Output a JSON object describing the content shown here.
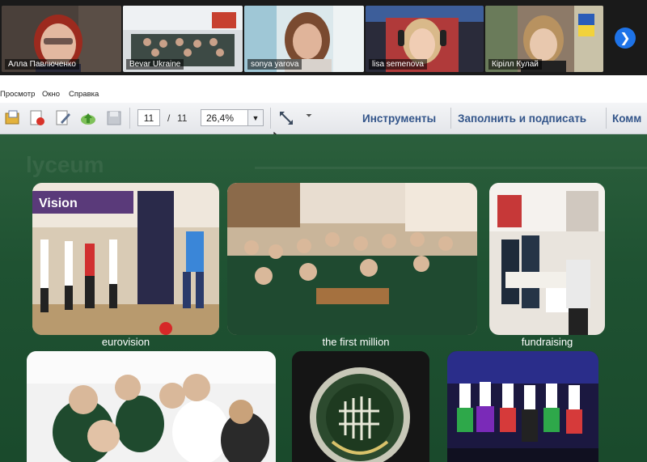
{
  "conference": {
    "participants": [
      {
        "name": "Алла Павлюченко"
      },
      {
        "name": "Bevar Ukraine"
      },
      {
        "name": "sonya yarova"
      },
      {
        "name": "lisa semenova"
      },
      {
        "name": "Кірілл Кулай"
      }
    ],
    "next_icon": "chevron-right-icon"
  },
  "menu": {
    "items": [
      "Просмотр",
      "Окно",
      "Справка"
    ]
  },
  "toolbar": {
    "page_current": "11",
    "page_separator": "/",
    "page_total": "11",
    "zoom": "26,4%",
    "tools_label": "Инструменты",
    "fill_sign_label": "Заполнить и подписать",
    "comment_label": "Комм"
  },
  "document": {
    "section_title": "lyceum",
    "captions": {
      "eurovision": "eurovision",
      "first_million": "the first million",
      "fundraising": "fundraising"
    },
    "eurovision_banner": "Vision"
  },
  "colors": {
    "slide_background": "#1f5232",
    "toolbar_link": "#33558a",
    "conference_bg": "#1a1a1a",
    "next_button": "#1e73e8"
  }
}
